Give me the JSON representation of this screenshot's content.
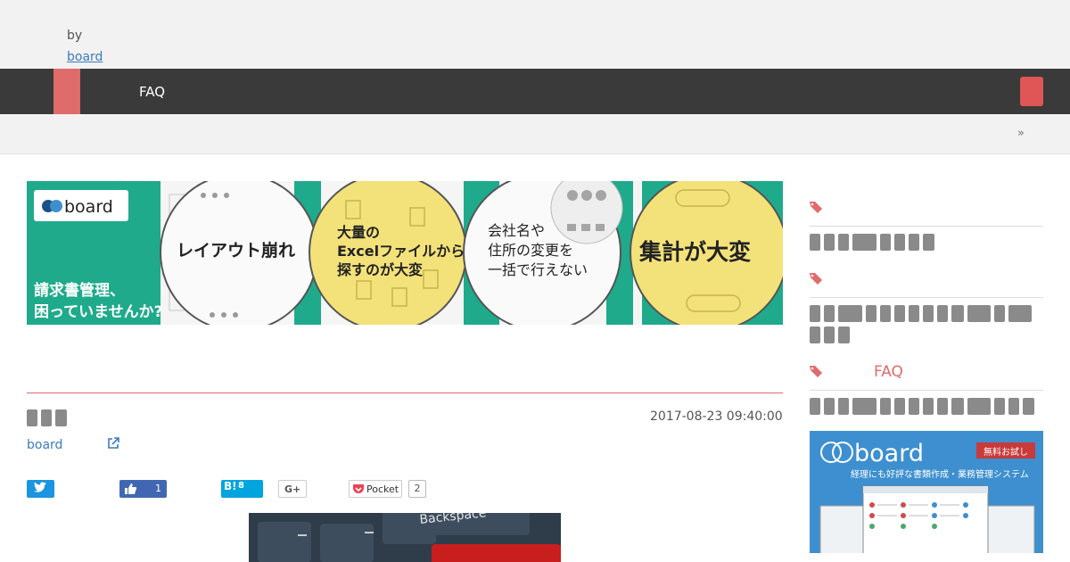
{
  "header": {
    "by_text": "by",
    "board_link": "board"
  },
  "nav": {
    "items": [
      "FAQ"
    ]
  },
  "breadcrumb": {
    "separator": "»"
  },
  "hero": {
    "brand": "board",
    "tagline_line1": "請求書管理、",
    "tagline_line2": "困っていませんか?",
    "bubble1": "レイアウト崩れ",
    "bubble2_line1": "大量の",
    "bubble2_line2": "Excelファイルから",
    "bubble2_line3": "探すのが大変",
    "bubble3_line1": "会社名や",
    "bubble3_line2": "住所の変更を",
    "bubble3_line3": "一括で行えない",
    "bubble4": "集計が大変"
  },
  "article": {
    "date": "2017-08-23 09:40:00",
    "author": "board",
    "share": {
      "facebook_count": "1",
      "hatena_label": "B!",
      "hatena_count": "8",
      "google_label": "G+",
      "pocket_label": "Pocket",
      "pocket_count": "2"
    },
    "image_key_label": "Backspace"
  },
  "sidebar": {
    "faq_label": "FAQ",
    "ad": {
      "brand": "board",
      "trial_label": "無料お試し",
      "tagline": "経理にも好評な書類作成・業務管理システム"
    }
  },
  "colors": {
    "accent": "#e06b6b",
    "navbar": "#3a3a3a",
    "hero_green": "#1faa8b",
    "bubble_yellow": "#f3e27a",
    "link_blue": "#3b7bbf"
  }
}
